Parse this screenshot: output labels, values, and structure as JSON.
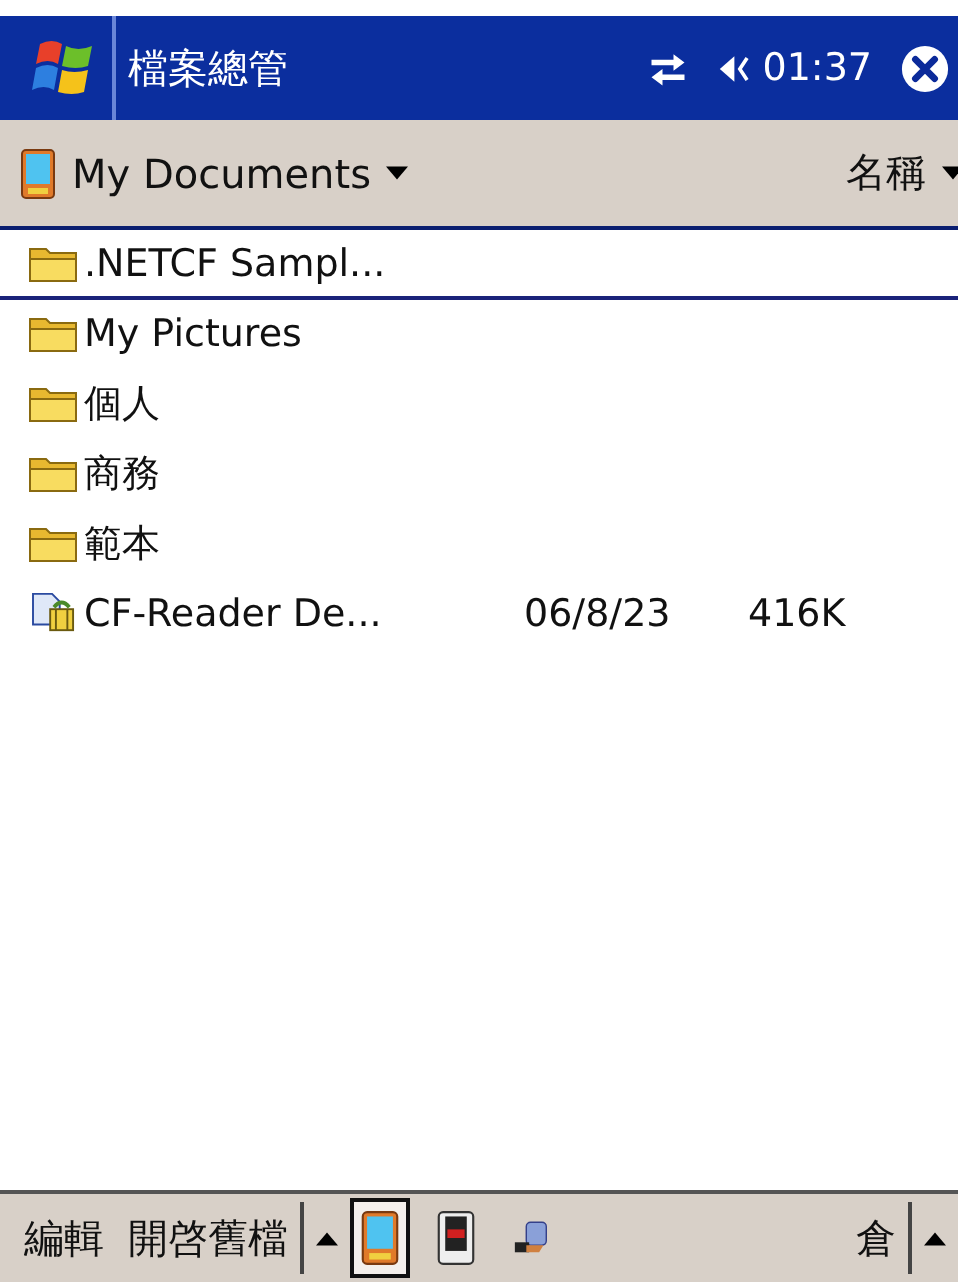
{
  "title_bar": {
    "title": "檔案總管",
    "time": "01:37"
  },
  "toolbar": {
    "location": "My Documents",
    "sort": "名稱"
  },
  "files": [
    {
      "kind": "folder",
      "name": ".NETCF Sampl...",
      "selected": true
    },
    {
      "kind": "folder",
      "name": "My Pictures",
      "selected": false
    },
    {
      "kind": "folder",
      "name": "個人",
      "selected": false
    },
    {
      "kind": "folder",
      "name": "商務",
      "selected": false
    },
    {
      "kind": "folder",
      "name": "範本",
      "selected": false
    },
    {
      "kind": "file",
      "name": "CF-Reader De...",
      "date": "06/8/23",
      "size": "416K",
      "selected": false
    }
  ],
  "menu_bar": {
    "items": [
      "編輯",
      "開啓舊檔"
    ],
    "tabs": [
      {
        "kind": "device",
        "selected": true
      },
      {
        "kind": "card",
        "selected": false
      },
      {
        "kind": "network",
        "selected": false
      }
    ],
    "input_method": "倉"
  }
}
